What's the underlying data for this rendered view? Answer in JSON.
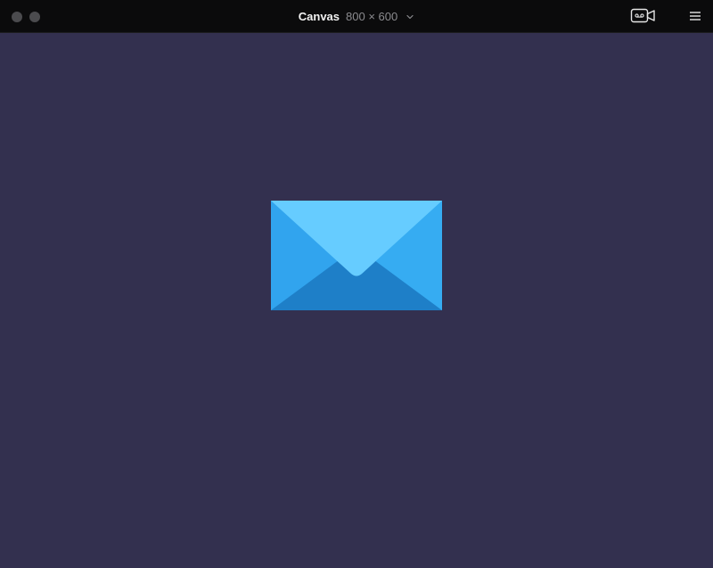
{
  "window": {
    "title": "Canvas",
    "size_label": "800 × 600"
  },
  "icons": {
    "dropdown": "chevron-down-icon",
    "record": "record-video-icon",
    "menu": "hamburger-menu-icon",
    "canvas_content": "envelope-icon"
  },
  "colors": {
    "canvas_background": "#33304f",
    "titlebar": "#0b0b0c",
    "envelope_back": "#2d9be6",
    "envelope_side": "#34a9f0",
    "envelope_bottom": "#1e7fc8",
    "envelope_flap": "#66ccff"
  }
}
